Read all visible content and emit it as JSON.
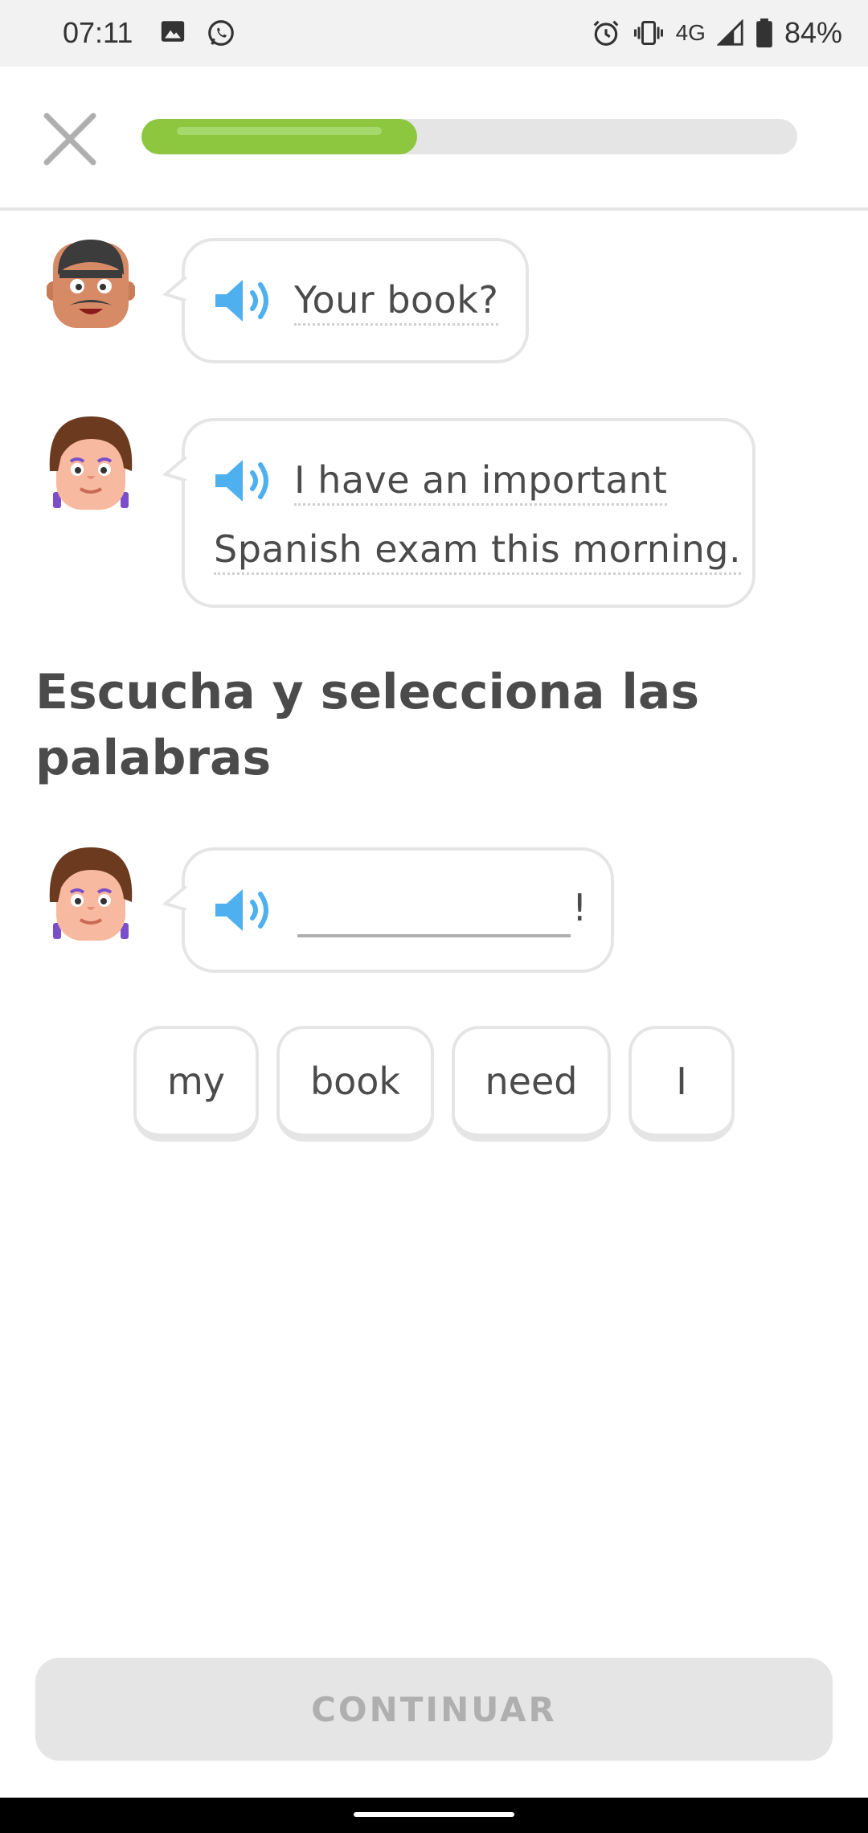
{
  "status_bar": {
    "time": "07:11",
    "network": "4G",
    "battery": "84%",
    "icons": [
      "image-icon",
      "whatsapp-icon",
      "alarm-icon",
      "vibrate-icon",
      "signal-icon",
      "battery-icon"
    ]
  },
  "header": {
    "close_icon": "close-icon",
    "progress_fraction": 0.42
  },
  "dialogue": [
    {
      "speaker": "man-mustache-avatar",
      "text": "Your book?"
    },
    {
      "speaker": "woman-avatar",
      "line1": "I have an important",
      "line2": "Spanish exam this morning."
    }
  ],
  "instruction": "Escucha y selecciona las palabras",
  "answer": {
    "speaker": "woman-avatar",
    "ending": "!"
  },
  "word_bank": [
    "my",
    "book",
    "need",
    "I"
  ],
  "continue_label": "CONTINUAR",
  "colors": {
    "progress": "#8dc73f",
    "speaker": "#4fb0f0",
    "border": "#e5e5e5",
    "text": "#4b4b4b"
  }
}
